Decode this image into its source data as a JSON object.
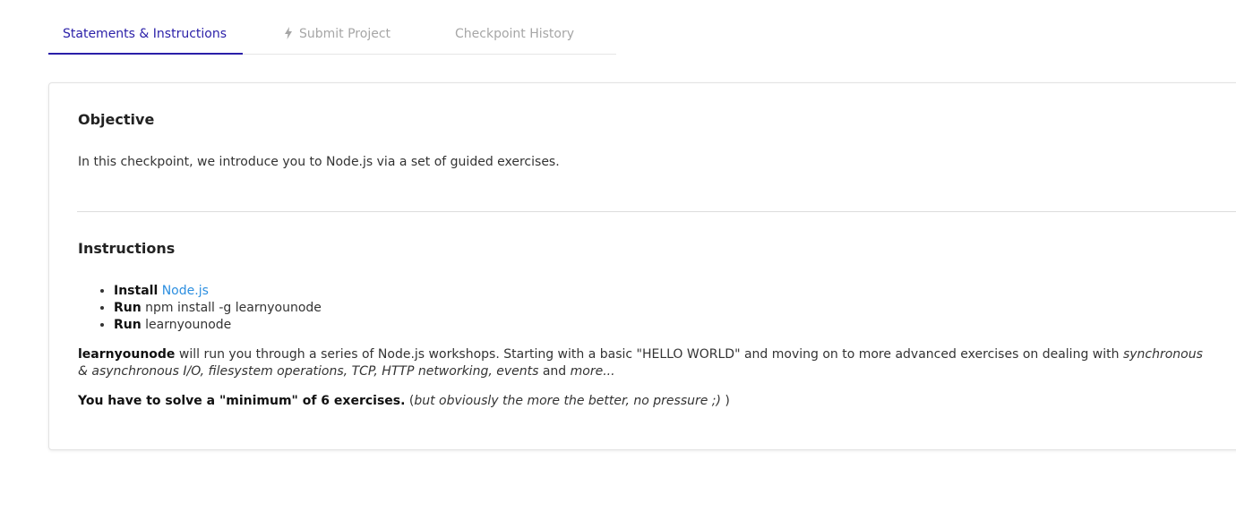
{
  "tabs": [
    {
      "label": "Statements & Instructions",
      "active": true
    },
    {
      "label": "Submit Project",
      "icon": "bolt-icon",
      "active": false
    },
    {
      "label": "Checkpoint History",
      "active": false
    }
  ],
  "objective": {
    "title": "Objective",
    "text": "In this checkpoint, we introduce you to Node.js via a set of guided exercises."
  },
  "instructions": {
    "title": "Instructions",
    "steps": [
      {
        "verb": "Install",
        "text": "Node.js",
        "is_link": true
      },
      {
        "verb": "Run",
        "text": "npm install -g learnyounode",
        "is_link": false
      },
      {
        "verb": "Run",
        "text": "learnyounode",
        "is_link": false
      }
    ],
    "para1": {
      "bold": "learnyounode",
      "text": " will run you through a series of Node.js workshops. Starting with a basic \"HELLO WORLD\" and moving on to more advanced exercises on dealing with ",
      "italic1": "synchronous & asynchronous I/O, filesystem operations, TCP, HTTP networking, events",
      "and": " and ",
      "italic2": "more..."
    },
    "para2": {
      "bold": "You have to solve a \"minimum\" of 6 exercises.",
      "open": " (",
      "italic": "but obviously the more the better, no pressure ;)",
      "close": " )"
    }
  },
  "colors": {
    "accent": "#2a1fa8",
    "link": "#2d8fe0",
    "inactive_tab": "#a6a6a6"
  }
}
